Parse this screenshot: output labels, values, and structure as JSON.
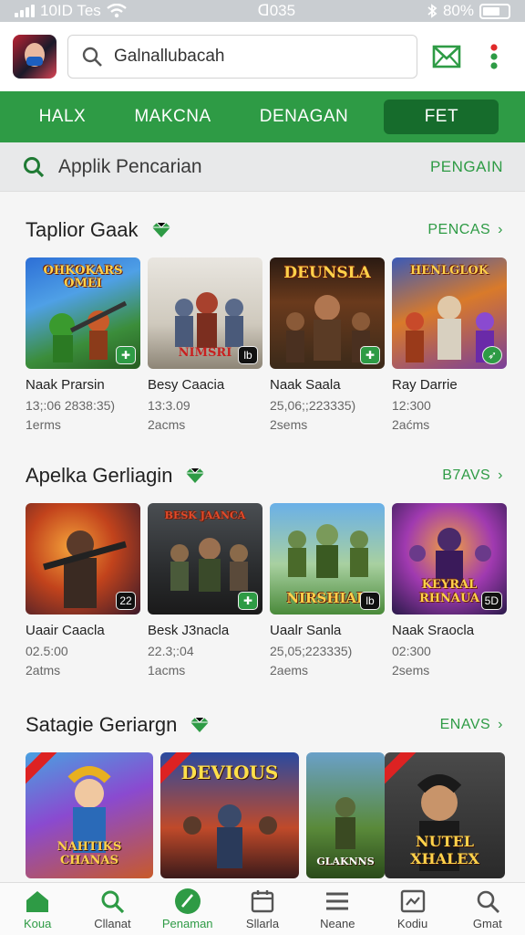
{
  "status_bar": {
    "left_text": "10ID Tes",
    "time": "ᗡ035",
    "battery": "80%"
  },
  "app_bar": {
    "search_value": "Galnallubacah"
  },
  "tabs": [
    {
      "label": "HALX",
      "active": false
    },
    {
      "label": "MAKCNA",
      "active": false
    },
    {
      "label": "DENAGAN",
      "active": false
    },
    {
      "label": "FET",
      "active": true
    }
  ],
  "sub_search": {
    "label": "Applik Pencarian",
    "action": "PENGAIN"
  },
  "sections": [
    {
      "title": "Taplior Gaak",
      "link": "PENCAS",
      "items": [
        {
          "thumb_title": "OHKOKARS OMEI",
          "badge": "✚",
          "name": "Naak Prarsin",
          "meta": "13;:06 2838:35)",
          "count": "1erms"
        },
        {
          "thumb_title": "NIMSRI",
          "badge": "lb",
          "name": "Besy Caacia",
          "meta": "13:3.09",
          "count": "2acms"
        },
        {
          "thumb_title": "DEUNSLA",
          "badge": "✚",
          "name": "Naak Saala",
          "meta": "25,06;;223335)",
          "count": "2sems"
        },
        {
          "thumb_title": "HENLGLOK",
          "badge": "➶",
          "name": "Ray Darrie",
          "meta": "12:300",
          "count": "2aćms"
        }
      ]
    },
    {
      "title": "Apelka Gerliagin",
      "link": "B7AVS",
      "items": [
        {
          "thumb_title": "",
          "badge": "22",
          "name": "Uaair Caacla",
          "meta": "02.5:00",
          "count": "2atms"
        },
        {
          "thumb_title": "BESK JAANCA",
          "badge": "✚",
          "name": "Besk J3nacla",
          "meta": "22.3;:04",
          "count": "1acms"
        },
        {
          "thumb_title": "NIRSHIAR",
          "badge": "lb",
          "name": "Uaalr Sanla",
          "meta": "25,05;223335)",
          "count": "2aems"
        },
        {
          "thumb_title": "KEYRAL RHNAUA",
          "badge": "5D",
          "name": "Naak Sraocla",
          "meta": "02:300",
          "count": "2sems"
        }
      ]
    },
    {
      "title": "Satagie Geriargn",
      "link": "ENAVS",
      "items": [
        {
          "thumb_title": "NAHTIKS CHANAS"
        },
        {
          "thumb_title": "DEVIOUS"
        },
        {
          "thumb_title": "GLAKNNS"
        },
        {
          "thumb_title": "NUTEL XHALEX"
        }
      ]
    }
  ],
  "bottom_nav": [
    {
      "label": "Koua",
      "icon": "home-icon",
      "active": true
    },
    {
      "label": "Cllanat",
      "icon": "search-icon",
      "active": false
    },
    {
      "label": "Penaman",
      "icon": "compass-icon",
      "active": true
    },
    {
      "label": "Sllarla",
      "icon": "calendar-icon",
      "active": false
    },
    {
      "label": "Neane",
      "icon": "menu-icon",
      "active": false
    },
    {
      "label": "Kodiu",
      "icon": "image-icon",
      "active": false
    },
    {
      "label": "Gmat",
      "icon": "search-icon",
      "active": false
    }
  ]
}
